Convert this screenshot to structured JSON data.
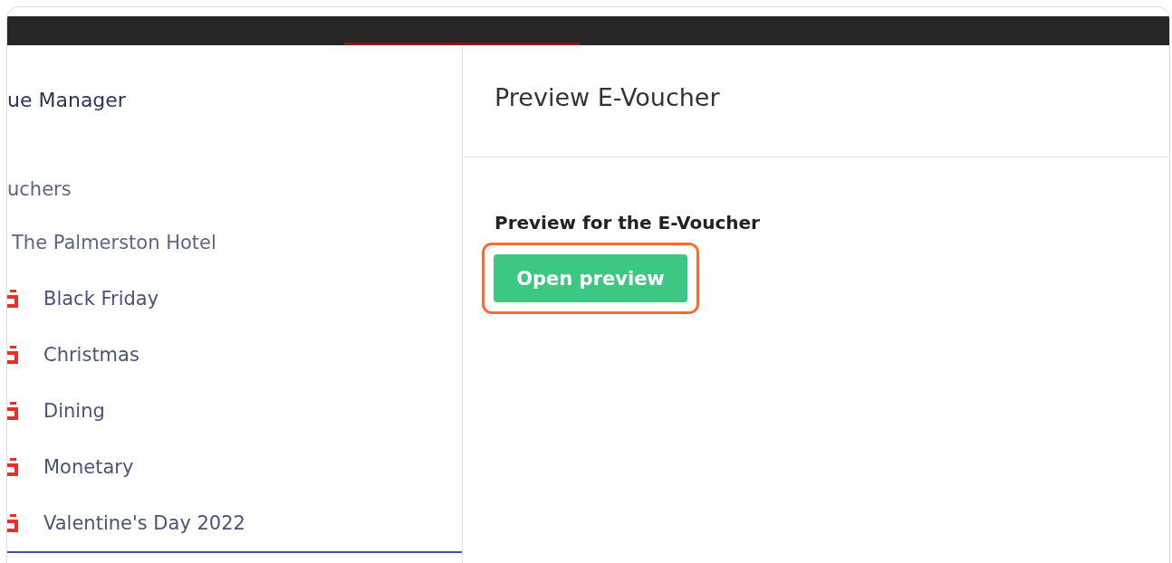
{
  "sidebar": {
    "title": "ue Manager",
    "section": "uchers",
    "hotel": "The Palmerston Hotel",
    "items": [
      {
        "label": "Black Friday"
      },
      {
        "label": "Christmas"
      },
      {
        "label": "Dining"
      },
      {
        "label": "Monetary"
      },
      {
        "label": "Valentine's Day 2022"
      }
    ]
  },
  "main": {
    "title": "Preview E-Voucher",
    "label": "Preview for the E-Voucher",
    "button": "Open preview",
    "highlighted": true
  }
}
